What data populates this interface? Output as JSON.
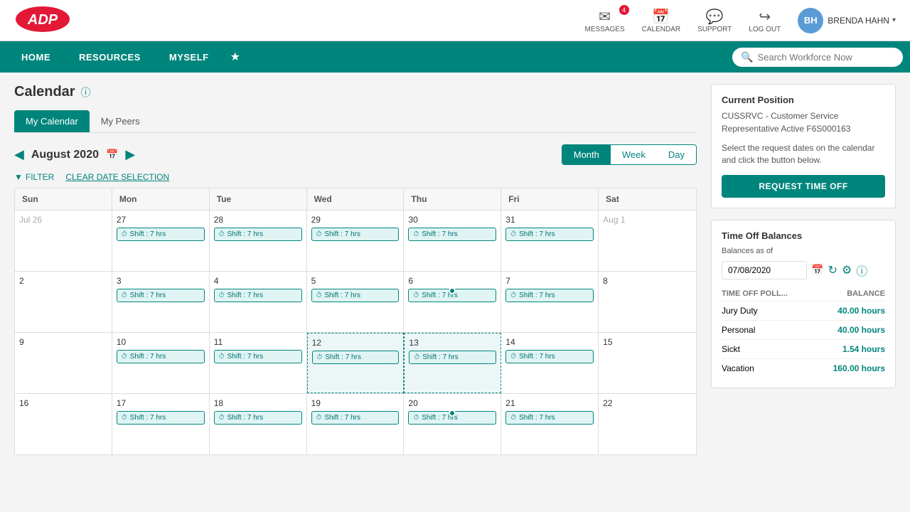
{
  "topBar": {
    "logo": "ADP",
    "icons": [
      {
        "name": "messages",
        "label": "MESSAGES",
        "badge": "4"
      },
      {
        "name": "calendar",
        "label": "CALENDAR",
        "badge": null
      },
      {
        "name": "support",
        "label": "SUPPORT",
        "badge": null
      },
      {
        "name": "logout",
        "label": "LOG OUT",
        "badge": null
      }
    ],
    "user": {
      "initials": "BH",
      "name": "BRENDA HAHN"
    }
  },
  "navBar": {
    "items": [
      "HOME",
      "RESOURCES",
      "MYSELF"
    ],
    "searchPlaceholder": "Search Workforce Now"
  },
  "page": {
    "title": "Calendar",
    "tabs": [
      "My Calendar",
      "My Peers"
    ]
  },
  "calendarHeader": {
    "month": "August 2020",
    "views": [
      "Month",
      "Week",
      "Day"
    ],
    "activeView": "Month",
    "filter": "FILTER",
    "clearDates": "CLEAR DATE SELECTION"
  },
  "calendarDays": {
    "headers": [
      "Sun",
      "Mon",
      "Tue",
      "Wed",
      "Thu",
      "Fri",
      "Sat"
    ],
    "weeks": [
      {
        "cells": [
          {
            "date": "Jul 26",
            "otherMonth": true,
            "shifts": [],
            "dot": false,
            "selected": false
          },
          {
            "date": "27",
            "otherMonth": false,
            "shifts": [
              "Shift : 7 hrs"
            ],
            "dot": false,
            "selected": false
          },
          {
            "date": "28",
            "otherMonth": false,
            "shifts": [
              "Shift : 7 hrs"
            ],
            "dot": false,
            "selected": false
          },
          {
            "date": "29",
            "otherMonth": false,
            "shifts": [
              "Shift : 7 hrs"
            ],
            "dot": false,
            "selected": false
          },
          {
            "date": "30",
            "otherMonth": false,
            "shifts": [
              "Shift : 7 hrs"
            ],
            "dot": false,
            "selected": false
          },
          {
            "date": "31",
            "otherMonth": false,
            "shifts": [
              "Shift : 7 hrs"
            ],
            "dot": false,
            "selected": false
          },
          {
            "date": "Aug 1",
            "otherMonth": true,
            "shifts": [],
            "dot": false,
            "selected": false
          }
        ]
      },
      {
        "cells": [
          {
            "date": "2",
            "otherMonth": false,
            "shifts": [],
            "dot": false,
            "selected": false
          },
          {
            "date": "3",
            "otherMonth": false,
            "shifts": [
              "Shift : 7 hrs"
            ],
            "dot": false,
            "selected": false
          },
          {
            "date": "4",
            "otherMonth": false,
            "shifts": [
              "Shift : 7 hrs"
            ],
            "dot": false,
            "selected": false
          },
          {
            "date": "5",
            "otherMonth": false,
            "shifts": [
              "Shift : 7 hrs"
            ],
            "dot": false,
            "selected": false
          },
          {
            "date": "6",
            "otherMonth": false,
            "shifts": [
              "Shift : 7 hrs"
            ],
            "dot": true,
            "selected": false
          },
          {
            "date": "7",
            "otherMonth": false,
            "shifts": [
              "Shift : 7 hrs"
            ],
            "dot": false,
            "selected": false
          },
          {
            "date": "8",
            "otherMonth": false,
            "shifts": [],
            "dot": false,
            "selected": false
          }
        ]
      },
      {
        "cells": [
          {
            "date": "9",
            "otherMonth": false,
            "shifts": [],
            "dot": false,
            "selected": false
          },
          {
            "date": "10",
            "otherMonth": false,
            "shifts": [
              "Shift : 7 hrs"
            ],
            "dot": false,
            "selected": false
          },
          {
            "date": "11",
            "otherMonth": false,
            "shifts": [
              "Shift : 7 hrs"
            ],
            "dot": false,
            "selected": false
          },
          {
            "date": "12",
            "otherMonth": false,
            "shifts": [
              "Shift : 7 hrs"
            ],
            "dot": false,
            "selected": true
          },
          {
            "date": "13",
            "otherMonth": false,
            "shifts": [
              "Shift : 7 hrs"
            ],
            "dot": false,
            "selected": true
          },
          {
            "date": "14",
            "otherMonth": false,
            "shifts": [
              "Shift : 7 hrs"
            ],
            "dot": false,
            "selected": false
          },
          {
            "date": "15",
            "otherMonth": false,
            "shifts": [],
            "dot": false,
            "selected": false
          }
        ]
      },
      {
        "cells": [
          {
            "date": "16",
            "otherMonth": false,
            "shifts": [],
            "dot": false,
            "selected": false
          },
          {
            "date": "17",
            "otherMonth": false,
            "shifts": [
              "Shift : 7 hrs"
            ],
            "dot": false,
            "selected": false
          },
          {
            "date": "18",
            "otherMonth": false,
            "shifts": [
              "Shift : 7 hrs"
            ],
            "dot": false,
            "selected": false
          },
          {
            "date": "19",
            "otherMonth": false,
            "shifts": [
              "Shift : 7 hrs"
            ],
            "dot": false,
            "selected": false
          },
          {
            "date": "20",
            "otherMonth": false,
            "shifts": [
              "Shift : 7 hrs"
            ],
            "dot": true,
            "selected": false
          },
          {
            "date": "21",
            "otherMonth": false,
            "shifts": [
              "Shift : 7 hrs"
            ],
            "dot": false,
            "selected": false
          },
          {
            "date": "22",
            "otherMonth": false,
            "shifts": [],
            "dot": false,
            "selected": false
          }
        ]
      }
    ]
  },
  "rightPanel": {
    "currentPosition": {
      "title": "Current Position",
      "description": "CUSSRVC - Customer Service Representative Active F6S000163",
      "hint": "Select the request dates on the calendar and click the button below.",
      "requestBtn": "REQUEST TIME OFF"
    },
    "timeOffBalances": {
      "title": "Time Off Balances",
      "subtitle": "Balances as of",
      "date": "07/08/2020",
      "columns": [
        "TIME OFF POLL...",
        "BALANCE"
      ],
      "rows": [
        {
          "type": "Jury Duty",
          "balance": "40.00 hours"
        },
        {
          "type": "Personal",
          "balance": "40.00 hours"
        },
        {
          "type": "Sickt",
          "balance": "1.54 hours"
        },
        {
          "type": "Vacation",
          "balance": "160.00 hours"
        }
      ]
    }
  }
}
